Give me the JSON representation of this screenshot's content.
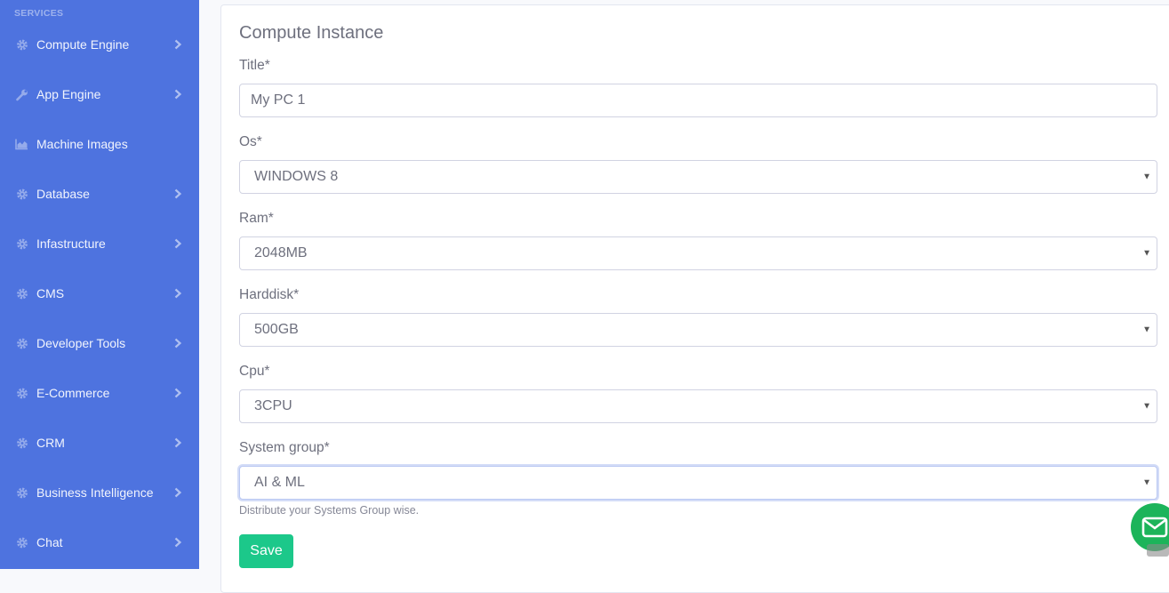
{
  "sidebar": {
    "heading": "SERVICES",
    "items": [
      {
        "label": "Compute Engine",
        "icon": "gear-icon",
        "has_submenu": true
      },
      {
        "label": "App Engine",
        "icon": "wrench-icon",
        "has_submenu": true
      },
      {
        "label": "Machine Images",
        "icon": "area-chart-icon",
        "has_submenu": false
      },
      {
        "label": "Database",
        "icon": "gear-icon",
        "has_submenu": true
      },
      {
        "label": "Infastructure",
        "icon": "gear-icon",
        "has_submenu": true
      },
      {
        "label": "CMS",
        "icon": "gear-icon",
        "has_submenu": true
      },
      {
        "label": "Developer Tools",
        "icon": "gear-icon",
        "has_submenu": true
      },
      {
        "label": "E-Commerce",
        "icon": "gear-icon",
        "has_submenu": true
      },
      {
        "label": "CRM",
        "icon": "gear-icon",
        "has_submenu": true
      },
      {
        "label": "Business Intelligence",
        "icon": "gear-icon",
        "has_submenu": true
      },
      {
        "label": "Chat",
        "icon": "gear-icon",
        "has_submenu": true
      }
    ]
  },
  "form": {
    "title": "Compute Instance",
    "fields": {
      "title": {
        "label": "Title*",
        "value": "My PC 1"
      },
      "os": {
        "label": "Os*",
        "value": "WINDOWS 8"
      },
      "ram": {
        "label": "Ram*",
        "value": "2048MB"
      },
      "harddisk": {
        "label": "Harddisk*",
        "value": "500GB"
      },
      "cpu": {
        "label": "Cpu*",
        "value": "3CPU"
      },
      "system_group": {
        "label": "System group*",
        "value": "AI & ML",
        "help": "Distribute your Systems Group wise."
      }
    },
    "save_label": "Save"
  },
  "colors": {
    "sidebar_bg": "#4e73df",
    "save_btn": "#1cc88a",
    "mail_fab": "#1cb45a",
    "label_text": "#6e707e"
  },
  "floating": {
    "mail_icon": "envelope-icon"
  }
}
